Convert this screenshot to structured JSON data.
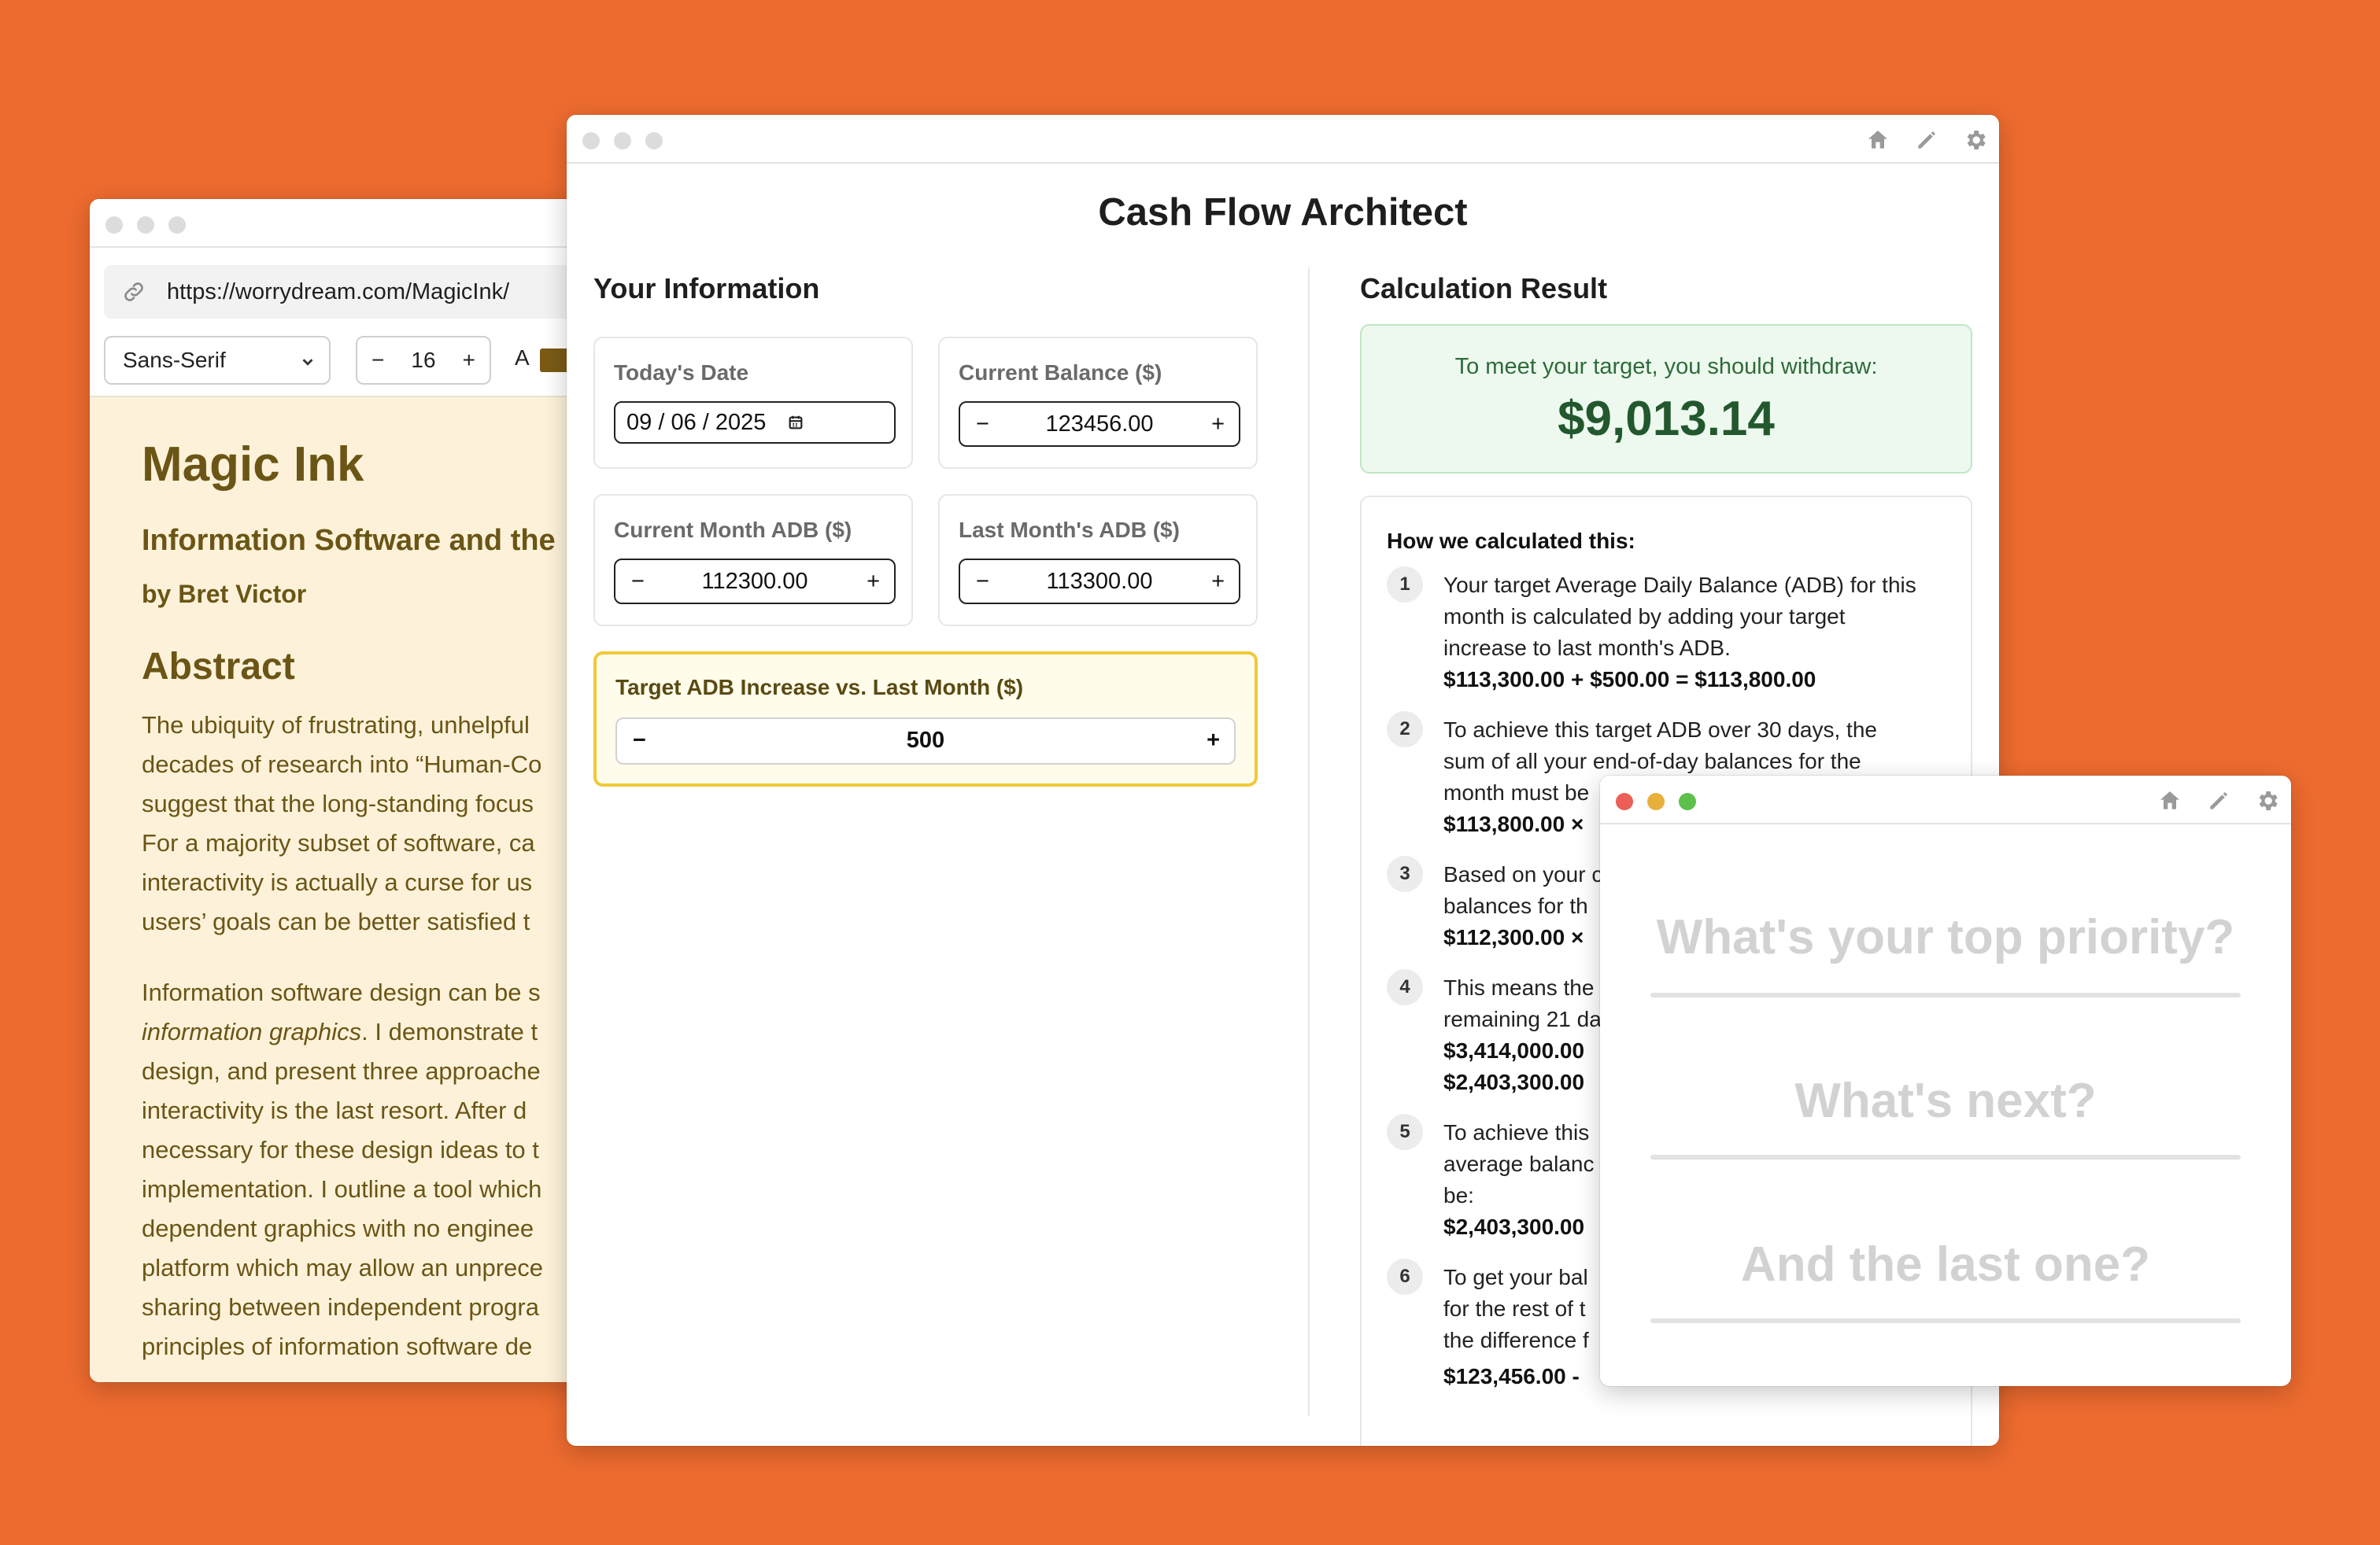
{
  "colors": {
    "background": "#ED6B2F",
    "accent_yellow": "#F0C93A",
    "result_green": "#23582f",
    "article_bg": "#FDF2D9"
  },
  "reader": {
    "url": "https://worrydream.com/MagicInk/",
    "font_family_option": "Sans-Serif",
    "font_size": "16",
    "minus": "−",
    "plus": "+",
    "color_label": "A",
    "title": "Magic Ink",
    "subtitle": "Information Software and the",
    "byline": "by Bret Victor",
    "abstract_heading": "Abstract",
    "paragraph1": [
      "The ubiquity of frustrating, unhelpful",
      "decades of research into “Human-Co",
      "suggest that the long-standing focus",
      "For a majority subset of software, ca",
      "interactivity is actually a curse for us",
      "users’ goals can be better satisfied t"
    ],
    "paragraph2_first": "Information software design can be s",
    "paragraph2_italic": "information graphics",
    "paragraph2_after_italic": ". I demonstrate t",
    "paragraph2": [
      "design, and present three approache",
      "interactivity is the last resort. After d",
      "necessary for these design ideas to t",
      "implementation. I outline a tool which",
      "dependent graphics with no enginee",
      "platform which may allow an unprece",
      "sharing between independent progra",
      "principles of information software de"
    ]
  },
  "cashflow": {
    "title": "Cash Flow Architect",
    "your_info_heading": "Your Information",
    "result_heading": "Calculation Result",
    "todays_date": {
      "label": "Today's Date",
      "month": "09",
      "day": "06",
      "year": "2025",
      "sep": "/"
    },
    "current_balance": {
      "label": "Current Balance ($)",
      "value": "123456.00"
    },
    "current_month_adb": {
      "label": "Current Month ADB ($)",
      "value": "112300.00"
    },
    "last_month_adb": {
      "label": "Last Month's ADB ($)",
      "value": "113300.00"
    },
    "target_increase": {
      "label": "Target ADB Increase vs. Last Month ($)",
      "value": "500"
    },
    "minus": "−",
    "plus": "+",
    "result_message": "To meet your target, you should withdraw:",
    "result_amount": "$9,013.14",
    "explain_heading": "How we calculated this:",
    "steps": [
      {
        "num": "1",
        "lines": [
          "Your target Average Daily Balance (ADB) for this",
          "month is calculated by adding your target",
          "increase to last month's ADB."
        ],
        "bold": "$113,300.00 + $500.00 = $113,800.00"
      },
      {
        "num": "2",
        "lines": [
          "To achieve this target ADB over 30 days, the",
          "sum of all your end-of-day balances for the",
          "month must be"
        ],
        "bold": "$113,800.00 ×"
      },
      {
        "num": "3",
        "lines": [
          "Based on your c",
          "balances for th"
        ],
        "bold": "$112,300.00 ×"
      },
      {
        "num": "4",
        "lines": [
          "This means the",
          "remaining 21 da"
        ],
        "bold": "$3,414,000.00",
        "bold2": "$2,403,300.00"
      },
      {
        "num": "5",
        "lines": [
          "To achieve this",
          "average balanc",
          "be:"
        ],
        "bold": "$2,403,300.00"
      },
      {
        "num": "6",
        "lines": [
          "To get your bal",
          "for the rest of t",
          "the difference f"
        ],
        "bold": "$123,456.00 -"
      }
    ]
  },
  "priorities": {
    "q1": "What's your top priority?",
    "q2": "What's next?",
    "q3": "And the last one?"
  }
}
